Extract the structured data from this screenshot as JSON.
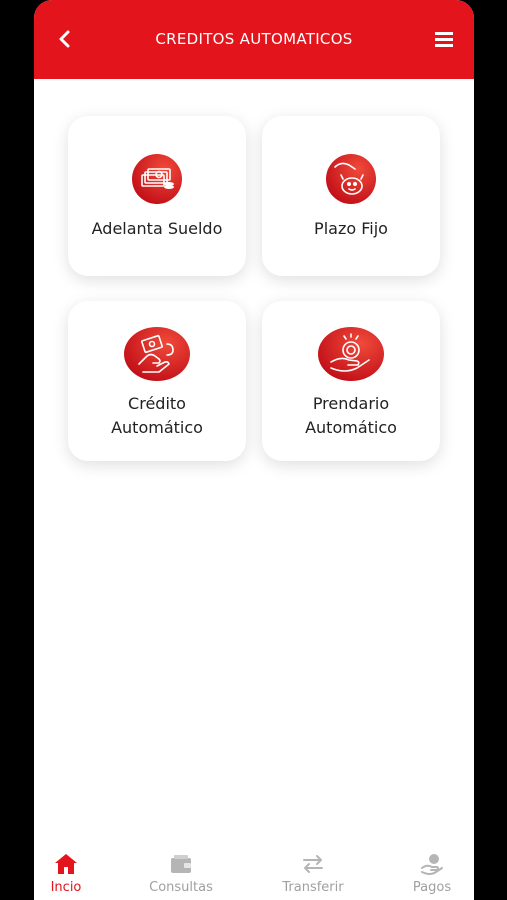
{
  "colors": {
    "brand_red": "#e3141b",
    "nav_inactive": "#a0a0a0"
  },
  "header": {
    "title": "CREDITOS AUTOMATICOS",
    "back_icon": "chevron-left-icon",
    "menu_icon": "hamburger-menu-icon"
  },
  "cards": [
    {
      "label": "Adelanta Sueldo",
      "icon": "cash-stack-icon"
    },
    {
      "label": "Plazo Fijo",
      "icon": "piggy-bank-icon"
    },
    {
      "label_line1": "Crédito",
      "label_line2": "Automático",
      "icon": "hand-money-icon"
    },
    {
      "label_line1": "Prendario",
      "label_line2": "Automático",
      "icon": "hand-coin-icon"
    }
  ],
  "nav": {
    "items": [
      {
        "label": "Incio",
        "icon": "home-icon",
        "active": true
      },
      {
        "label": "Consultas",
        "icon": "wallet-icon",
        "active": false
      },
      {
        "label": "Transferir",
        "icon": "transfer-arrows-icon",
        "active": false
      },
      {
        "label": "Pagos",
        "icon": "hand-coin-icon",
        "active": false
      }
    ]
  }
}
